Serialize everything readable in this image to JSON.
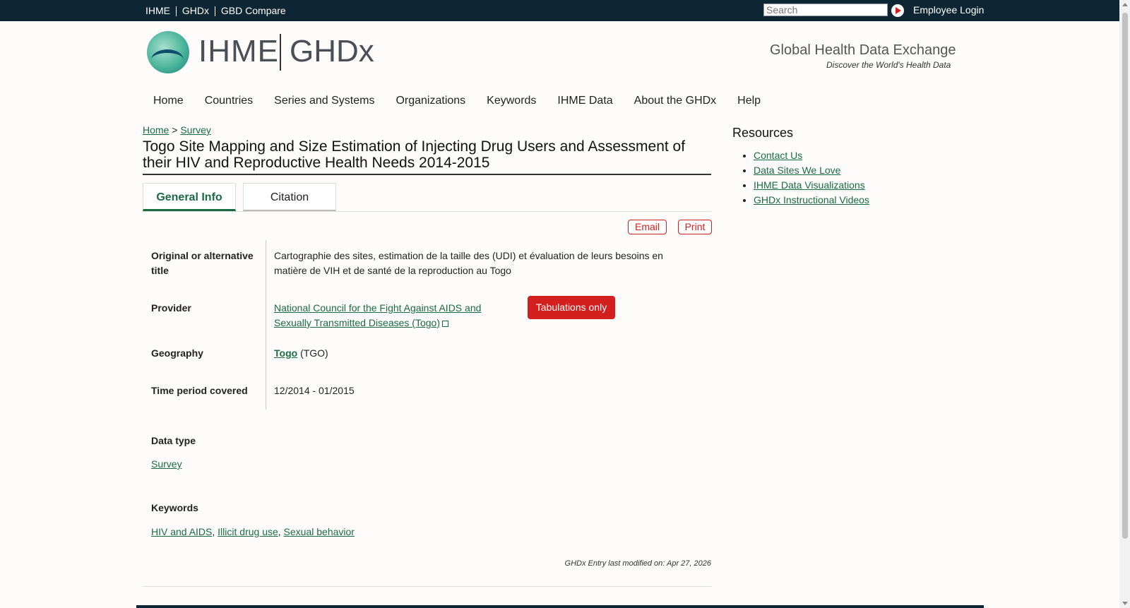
{
  "topbar": {
    "links": [
      "IHME",
      "GHDx",
      "GBD Compare"
    ],
    "search_placeholder": "Search",
    "login": "Employee Login"
  },
  "header": {
    "logo_ihme": "IHME",
    "logo_ghdx": "GHDx",
    "tagline": "Global Health Data Exchange",
    "subtagline": "Discover the World's Health Data"
  },
  "nav": [
    "Home",
    "Countries",
    "Series and Systems",
    "Organizations",
    "Keywords",
    "IHME Data",
    "About the GHDx",
    "Help"
  ],
  "breadcrumb": {
    "home": "Home",
    "sep": ">",
    "current": "Survey"
  },
  "title": "Togo Site Mapping and Size Estimation of Injecting Drug Users and Assessment of their HIV and Reproductive Health Needs 2014-2015",
  "tabs": [
    "General Info",
    "Citation"
  ],
  "actions": {
    "email": "Email",
    "print": "Print"
  },
  "details": {
    "alt_title_label": "Original or alternative title",
    "alt_title": "Cartographie des sites, estimation de la taille des (UDI) et évaluation de leurs besoins en matière de VIH et de santé de la reproduction au Togo",
    "provider_label": "Provider",
    "provider": "National Council for the Fight Against AIDS and Sexually Transmitted Diseases (Togo)",
    "tabulations": "Tabulations only",
    "geography_label": "Geography",
    "geography_link": "Togo",
    "geography_code": "(TGO)",
    "time_label": "Time period covered",
    "time": "12/2014 - 01/2015",
    "datatype_label": "Data type",
    "datatype": "Survey",
    "keywords_label": "Keywords",
    "keywords": [
      "HIV and AIDS",
      "Illicit drug use",
      "Sexual behavior"
    ],
    "keyword_sep": ", "
  },
  "modified": "GHDx Entry last modified on: Apr 27, 2026",
  "sidebar": {
    "title": "Resources",
    "links": [
      "Contact Us",
      "Data Sites We Love",
      "IHME Data Visualizations",
      "GHDx Instructional Videos"
    ]
  },
  "colors": {
    "accent_green": "#1a6b44",
    "accent_red": "#d41f1f",
    "topbar": "#0e2633"
  },
  "icons": [
    "play-arrow-icon",
    "external-link-icon",
    "ihme-logo-icon"
  ]
}
